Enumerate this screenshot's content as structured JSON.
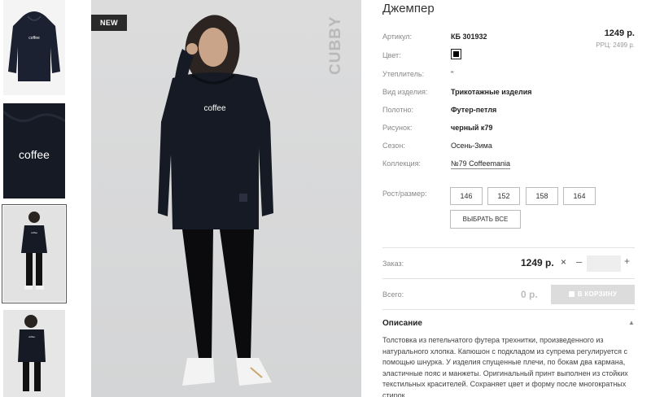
{
  "badge": "NEW",
  "brand": "CUBBY",
  "thumbs": [
    {
      "text": "coffee"
    },
    {
      "text": "coffee"
    },
    {
      "text": "coffee"
    },
    {
      "text": "coffee"
    }
  ],
  "product": {
    "title": "Джемпер",
    "price": "1249 р.",
    "rrp": "РРЦ: 2499 р.",
    "attributes": [
      {
        "label": "Артикул:",
        "value": "КБ 301932"
      },
      {
        "label": "Цвет:",
        "value": ""
      },
      {
        "label": "Утеплитель:",
        "value": "\""
      },
      {
        "label": "Вид изделия:",
        "value": "Трикотажные изделия"
      },
      {
        "label": "Полотно:",
        "value": "Футер-петля"
      },
      {
        "label": "Рисунок:",
        "value": "черный к79"
      },
      {
        "label": "Сезон:",
        "value": "Осень-Зима"
      },
      {
        "label": "Коллекция:",
        "value": "№79 Coffeemania"
      }
    ],
    "color_hex": "#000000",
    "sizes_label": "Рост/размер:",
    "sizes": [
      "146",
      "152",
      "158",
      "164"
    ],
    "select_all": "ВЫБРАТЬ ВСЕ"
  },
  "order": {
    "label": "Заказ:",
    "price": "1249 р.",
    "multiply": "×",
    "minus": "–",
    "plus": "+",
    "qty": ""
  },
  "total": {
    "label": "Всего:",
    "value": "0 р.",
    "cart_button": "В КОРЗИНУ"
  },
  "description": {
    "heading": "Описание",
    "text": "Толстовка из петельчатого футера трехнитки, произведенного из натурального хлопка. Капюшон с подкладом из супрема регулируется с помощью шнурка. У изделия спущенные плечи, по бокам два кармана, эластичные пояс и манжеты. Оригинальный принт выполнен из стойких текстильных красителей. Сохраняет цвет и форму после многократных стирок."
  }
}
